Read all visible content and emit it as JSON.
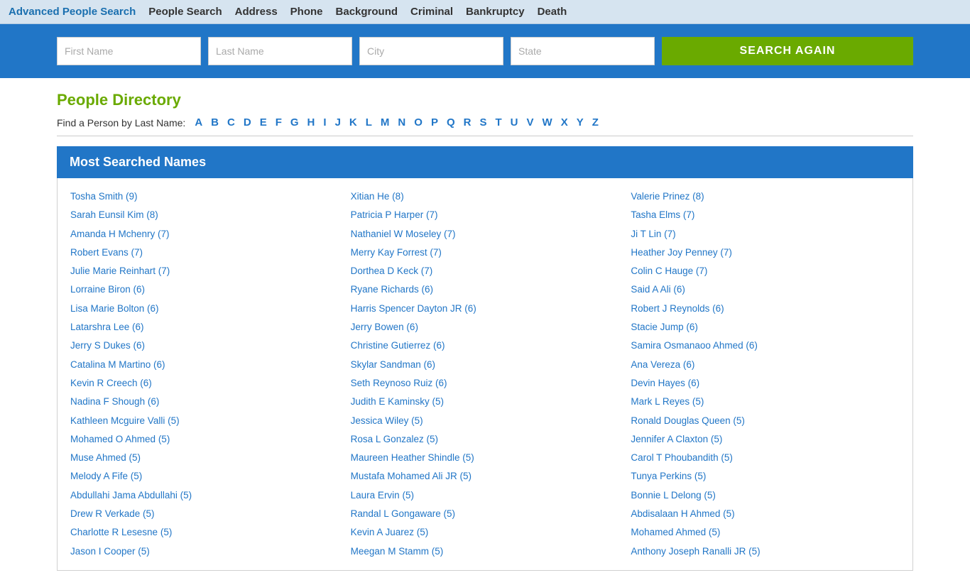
{
  "nav": {
    "links": [
      {
        "label": "Advanced People Search",
        "active": true
      },
      {
        "label": "People Search",
        "active": false
      },
      {
        "label": "Address",
        "active": false
      },
      {
        "label": "Phone",
        "active": false
      },
      {
        "label": "Background",
        "active": false
      },
      {
        "label": "Criminal",
        "active": false
      },
      {
        "label": "Bankruptcy",
        "active": false
      },
      {
        "label": "Death",
        "active": false
      }
    ]
  },
  "search": {
    "first_name_placeholder": "First Name",
    "last_name_placeholder": "Last Name",
    "city_placeholder": "City",
    "state_placeholder": "State",
    "button_label": "SEARCH AGAIN"
  },
  "directory": {
    "title": "People Directory",
    "subtitle": "Find a Person by Last Name:",
    "letters": [
      "A",
      "B",
      "C",
      "D",
      "E",
      "F",
      "G",
      "H",
      "I",
      "J",
      "K",
      "L",
      "M",
      "N",
      "O",
      "P",
      "Q",
      "R",
      "S",
      "T",
      "U",
      "V",
      "W",
      "X",
      "Y",
      "Z"
    ]
  },
  "most_searched": {
    "title": "Most Searched Names",
    "col1": [
      "Tosha Smith (9)",
      "Sarah Eunsil Kim (8)",
      "Amanda H Mchenry (7)",
      "Robert Evans (7)",
      "Julie Marie Reinhart (7)",
      "Lorraine Biron (6)",
      "Lisa Marie Bolton (6)",
      "Latarshra Lee (6)",
      "Jerry S Dukes (6)",
      "Catalina M Martino (6)",
      "Kevin R Creech (6)",
      "Nadina F Shough (6)",
      "Kathleen Mcguire Valli (5)",
      "Mohamed O Ahmed (5)",
      "Muse Ahmed (5)",
      "Melody A Fife (5)",
      "Abdullahi Jama Abdullahi (5)",
      "Drew R Verkade (5)",
      "Charlotte R Lesesne (5)",
      "Jason I Cooper (5)"
    ],
    "col2": [
      "Xitian He (8)",
      "Patricia P Harper (7)",
      "Nathaniel W Moseley (7)",
      "Merry Kay Forrest (7)",
      "Dorthea D Keck (7)",
      "Ryane Richards (6)",
      "Harris Spencer Dayton JR (6)",
      "Jerry Bowen (6)",
      "Christine Gutierrez (6)",
      "Skylar Sandman (6)",
      "Seth Reynoso Ruiz (6)",
      "Judith E Kaminsky (5)",
      "Jessica Wiley (5)",
      "Rosa L Gonzalez (5)",
      "Maureen Heather Shindle (5)",
      "Mustafa Mohamed Ali JR (5)",
      "Laura Ervin (5)",
      "Randal L Gongaware (5)",
      "Kevin A Juarez (5)",
      "Meegan M Stamm (5)"
    ],
    "col3": [
      "Valerie Prinez (8)",
      "Tasha Elms (7)",
      "Ji T Lin (7)",
      "Heather Joy Penney (7)",
      "Colin C Hauge (7)",
      "Said A Ali (6)",
      "Robert J Reynolds (6)",
      "Stacie Jump (6)",
      "Samira Osmanaoo Ahmed (6)",
      "Ana Vereza (6)",
      "Devin Hayes (6)",
      "Mark L Reyes (5)",
      "Ronald Douglas Queen (5)",
      "Jennifer A Claxton (5)",
      "Carol T Phoubandith (5)",
      "Tunya Perkins (5)",
      "Bonnie L Delong (5)",
      "Abdisalaan H Ahmed (5)",
      "Mohamed Ahmed (5)",
      "Anthony Joseph Ranalli JR (5)"
    ]
  }
}
